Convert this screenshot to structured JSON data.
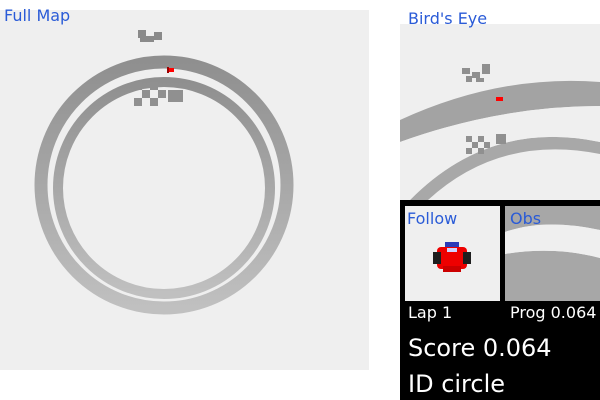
{
  "labels": {
    "full_map": "Full Map",
    "birds_eye": "Bird's Eye",
    "follow": "Follow",
    "obs": "Obs"
  },
  "hud": {
    "lap": "Lap 1",
    "progress": "Prog 0.064",
    "score": "Score 0.064",
    "track_id": "ID circle"
  },
  "colors": {
    "track": "#a0a0a0",
    "background": "#efefef",
    "label": "#2a5bd7",
    "car": "#ff0000",
    "hud_bg": "#000000"
  },
  "icons": {
    "car": "red-race-car-icon",
    "flag": "start-flag-icon"
  }
}
